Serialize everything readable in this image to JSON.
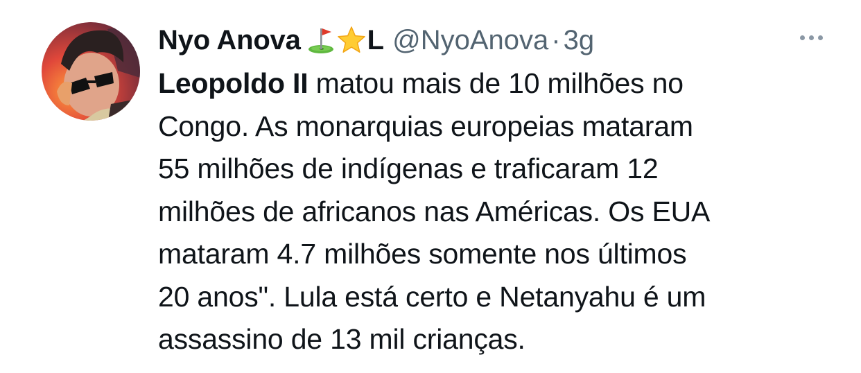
{
  "author": {
    "display_name": "Nyo Anova",
    "name_suffix": "L",
    "handle": "@NyoAnova",
    "separator": "·",
    "time": "3g",
    "badges": [
      "golf-flag-emoji",
      "star-emoji"
    ]
  },
  "menu": {
    "icon": "more-horizontal-icon"
  },
  "tweet": {
    "lead_bold": "Leopoldo II",
    "lines": [
      " matou mais de 10 milhões no",
      "Congo. As monarquias europeias mataram",
      "55 milhões de indígenas e traficaram 12",
      "milhões de africanos nas Américas. Os EUA",
      "mataram 4.7 milhões somente nos últimos",
      "20 anos\". Lula está certo e Netanyahu é um",
      "assassino de 13 mil crianças."
    ]
  },
  "colors": {
    "text": "#0f1419",
    "secondary": "#536471",
    "background": "#ffffff"
  }
}
